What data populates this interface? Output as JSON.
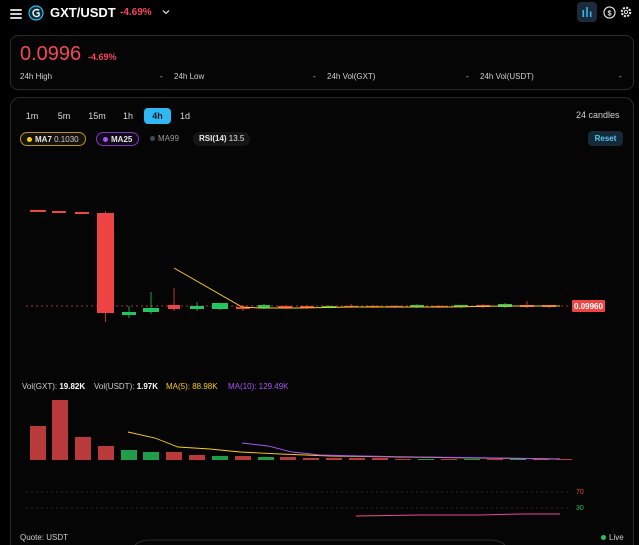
{
  "header": {
    "pair": "GXT/USDT",
    "change": "-4.69%",
    "icons": [
      "menu-icon",
      "token-logo",
      "chevron-down-icon",
      "chart-icon",
      "dollar-icon",
      "gear-icon"
    ]
  },
  "price_card": {
    "price": "0.0996",
    "change": "-4.69%",
    "stats": [
      {
        "label": "24h High",
        "value": "-"
      },
      {
        "label": "24h Low",
        "value": "-"
      },
      {
        "label": "24h Vol(GXT)",
        "value": "-"
      },
      {
        "label": "24h Vol(USDT)",
        "value": "-"
      }
    ]
  },
  "toolbar": {
    "timeframes": [
      "1m",
      "5m",
      "15m",
      "1h",
      "4h",
      "1d"
    ],
    "active_timeframe": "4h",
    "candle_count": "24 candles",
    "reset_label": "Reset"
  },
  "indicators": [
    {
      "name": "MA7",
      "value": "0.1030",
      "color": "#facc15"
    },
    {
      "name": "MA25",
      "value": "",
      "color": "#a855f7"
    },
    {
      "name": "MA99",
      "value": "",
      "color": "#3b4a5a"
    },
    {
      "name": "RSI(14)",
      "value": "13.5",
      "color": ""
    }
  ],
  "chart": {
    "current_price_label": "0.09960",
    "rsi_levels": [
      "70",
      "30"
    ]
  },
  "volume_legend": {
    "vol_gxt": {
      "label": "Vol(GXT):",
      "value": "19.82K"
    },
    "vol_usdt": {
      "label": "Vol(USDT):",
      "value": "1.97K"
    },
    "ma5": "MA(5): 88.98K",
    "ma10": "MA(10): 129.49K"
  },
  "footer": {
    "quote": "Quote: USDT",
    "live": "Live"
  },
  "colors": {
    "up": "#22c55e",
    "down": "#ef4444",
    "accent": "#2fb8f3",
    "ma_yellow": "#facc15",
    "ma_purple": "#a855f7"
  }
}
